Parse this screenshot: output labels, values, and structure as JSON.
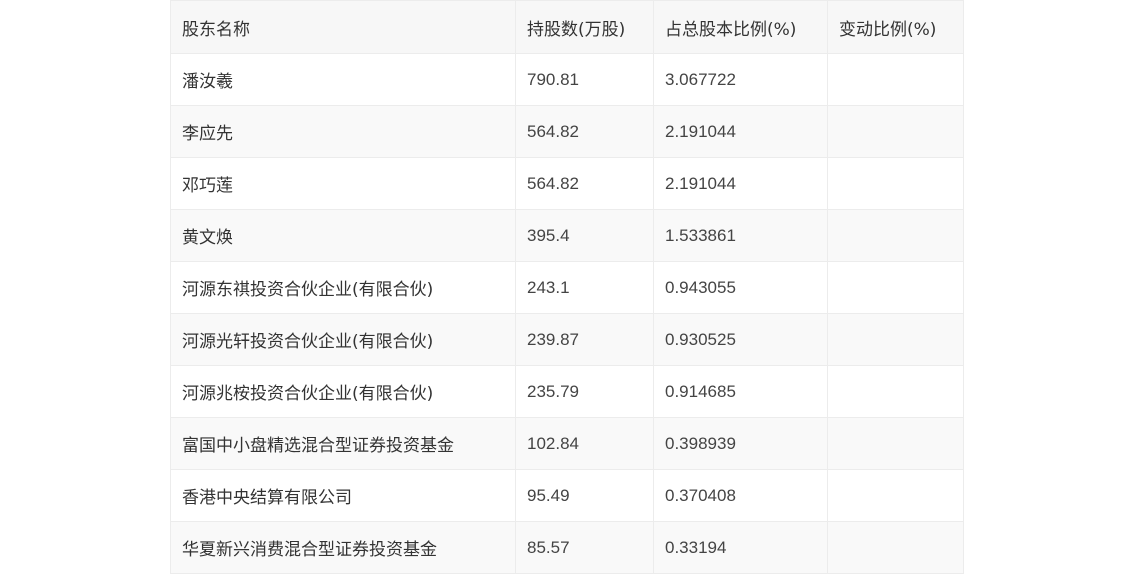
{
  "table": {
    "headers": [
      "股东名称",
      "持股数(万股)",
      "占总股本比例(%)",
      "变动比例(%)"
    ],
    "rows": [
      [
        "潘汝羲",
        "790.81",
        "3.067722",
        ""
      ],
      [
        "李应先",
        "564.82",
        "2.191044",
        ""
      ],
      [
        "邓巧莲",
        "564.82",
        "2.191044",
        ""
      ],
      [
        "黄文焕",
        "395.4",
        "1.533861",
        ""
      ],
      [
        "河源东祺投资合伙企业(有限合伙)",
        "243.1",
        "0.943055",
        ""
      ],
      [
        "河源光轩投资合伙企业(有限合伙)",
        "239.87",
        "0.930525",
        ""
      ],
      [
        "河源兆桉投资合伙企业(有限合伙)",
        "235.79",
        "0.914685",
        ""
      ],
      [
        "富国中小盘精选混合型证券投资基金",
        "102.84",
        "0.398939",
        ""
      ],
      [
        "香港中央结算有限公司",
        "95.49",
        "0.370408",
        ""
      ],
      [
        "华夏新兴消费混合型证券投资基金",
        "85.57",
        "0.33194",
        ""
      ]
    ]
  }
}
